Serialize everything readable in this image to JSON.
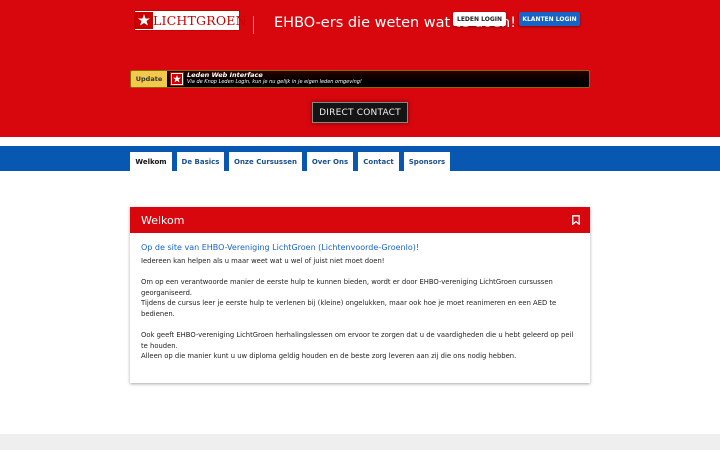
{
  "header": {
    "logo_text": "LICHTGROEN",
    "tagline": "EHBO-ers die weten wat te doen!",
    "leden_login": "LEDEN LOGIN",
    "klanten_login": "KLANTEN LOGIN",
    "update": {
      "label": "Update",
      "title": "Leden Web Interface",
      "subtitle": "Via de Knop Leden Login, kun je nu gelijk in je eigen leden omgeving!"
    },
    "direct_contact": "DIRECT CONTACT"
  },
  "nav": {
    "tabs": [
      {
        "label": "Welkom",
        "active": true
      },
      {
        "label": "De Basics"
      },
      {
        "label": "Onze Cursussen"
      },
      {
        "label": "Over Ons"
      },
      {
        "label": "Contact"
      },
      {
        "label": "Sponsors"
      }
    ]
  },
  "panel": {
    "heading": "Welkom",
    "title": "Op de site van EHBO-Vereniging LichtGroen (Lichtenvoorde-Groenlo)!",
    "p1": "Iedereen kan helpen als u maar weet wat u wel of juist niet moet doen!",
    "p2a": "Om op een verantwoorde manier de eerste hulp te kunnen bieden, wordt er door EHBO-vereniging LichtGroen cursussen georganiseerd.",
    "p2b": "Tijdens de cursus leer je eerste hulp te verlenen bij (kleine) ongelukken, maar ook hoe je moet reanimeren en een AED te bedienen.",
    "p3a": "Ook geeft EHBO-vereniging LichtGroen herhalingslessen om ervoor te zorgen dat u de vaardigheden die u hebt geleerd op peil te houden.",
    "p3b": "Alleen op die manier kunt u uw diploma geldig houden en de beste zorg leveren aan zij die ons nodig hebben."
  },
  "colors": {
    "brand_red": "#d7070d",
    "nav_blue": "#0857b1",
    "link_blue": "#1763c6"
  },
  "icons": [
    "logo-cross-icon",
    "bookmark-icon"
  ]
}
